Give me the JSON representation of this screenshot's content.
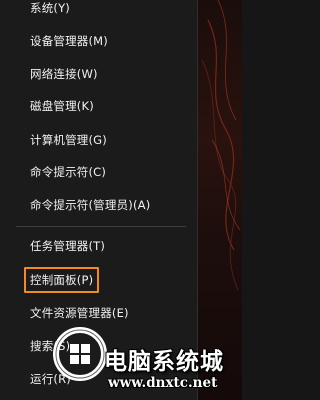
{
  "menu": {
    "items": [
      {
        "label": "系统(Y)"
      },
      {
        "label": "设备管理器(M)"
      },
      {
        "label": "网络连接(W)"
      },
      {
        "label": "磁盘管理(K)"
      },
      {
        "label": "计算机管理(G)"
      },
      {
        "label": "命令提示符(C)"
      },
      {
        "label": "命令提示符(管理员)(A)"
      },
      {
        "label": "任务管理器(T)"
      },
      {
        "label": "控制面板(P)",
        "highlighted": true
      },
      {
        "label": "文件资源管理器(E)"
      },
      {
        "label": "搜索(S)"
      },
      {
        "label": "运行(R)"
      }
    ],
    "highlight_color": "#f08a24"
  },
  "watermark": {
    "title": "电脑系统城",
    "url": "www.dnxtc.net"
  }
}
